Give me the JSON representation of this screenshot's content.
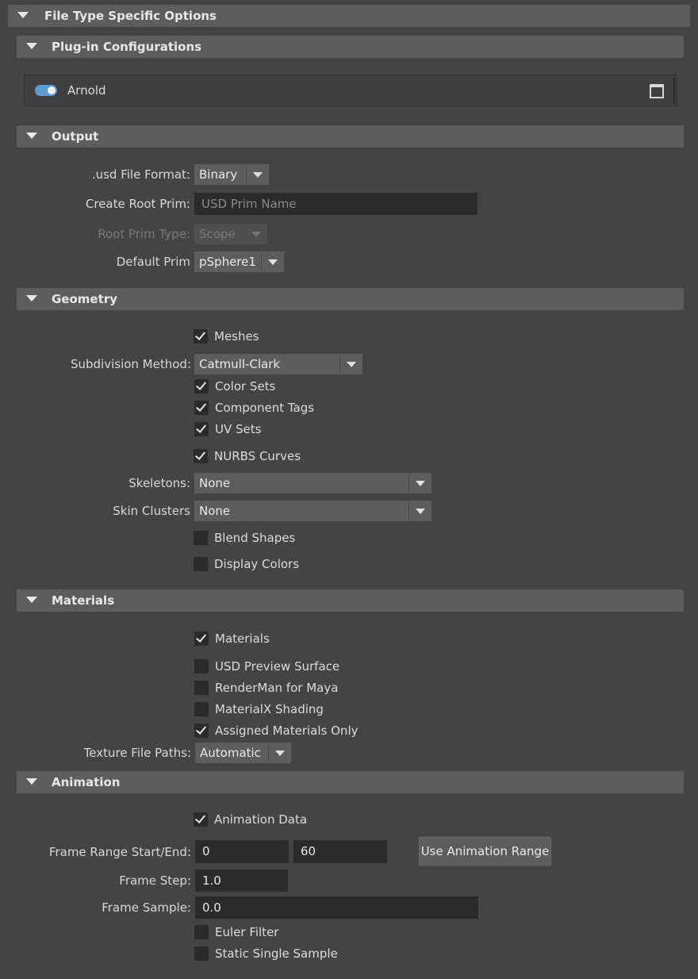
{
  "file_type_options": {
    "title": "File Type Specific Options"
  },
  "plugin_config": {
    "title": "Plug-in Configurations",
    "arnold_label": "Arnold",
    "arnold_enabled": true
  },
  "output": {
    "title": "Output",
    "file_format_label": ".usd File Format:",
    "file_format_value": "Binary",
    "root_prim_label": "Create Root Prim:",
    "root_prim_placeholder": "USD Prim Name",
    "root_prim_type_label": "Root Prim Type:",
    "root_prim_type_value": "Scope",
    "default_prim_label": "Default Prim",
    "default_prim_value": "pSphere1"
  },
  "geometry": {
    "title": "Geometry",
    "meshes": {
      "label": "Meshes",
      "checked": true
    },
    "subdivision_label": "Subdivision Method:",
    "subdivision_value": "Catmull-Clark",
    "color_sets": {
      "label": "Color Sets",
      "checked": true
    },
    "component_tags": {
      "label": "Component Tags",
      "checked": true
    },
    "uv_sets": {
      "label": "UV Sets",
      "checked": true
    },
    "nurbs_curves": {
      "label": "NURBS Curves",
      "checked": true
    },
    "skeletons_label": "Skeletons:",
    "skeletons_value": "None",
    "skin_clusters_label": "Skin Clusters",
    "skin_clusters_value": "None",
    "blend_shapes": {
      "label": "Blend Shapes",
      "checked": false
    },
    "display_colors": {
      "label": "Display Colors",
      "checked": false
    }
  },
  "materials": {
    "title": "Materials",
    "materials": {
      "label": "Materials",
      "checked": true
    },
    "usd_preview": {
      "label": "USD Preview Surface",
      "checked": false
    },
    "renderman": {
      "label": "RenderMan for Maya",
      "checked": false
    },
    "materialx": {
      "label": "MaterialX Shading",
      "checked": false
    },
    "assigned_only": {
      "label": "Assigned Materials Only",
      "checked": true
    },
    "texture_paths_label": "Texture File Paths:",
    "texture_paths_value": "Automatic"
  },
  "animation": {
    "title": "Animation",
    "animation_data": {
      "label": "Animation Data",
      "checked": true
    },
    "frame_range_label": "Frame Range Start/End:",
    "frame_start": "0",
    "frame_end": "60",
    "use_range_button": "Use Animation Range",
    "frame_step_label": "Frame Step:",
    "frame_step": "1.0",
    "frame_sample_label": "Frame Sample:",
    "frame_sample": "0.0",
    "euler_filter": {
      "label": "Euler Filter",
      "checked": false
    },
    "static_single": {
      "label": "Static Single Sample",
      "checked": false
    }
  },
  "colors": {
    "background": "#444444",
    "header": "#5d5d5d",
    "field": "#2b2b2b",
    "toggle_on": "#5b9bd5"
  }
}
